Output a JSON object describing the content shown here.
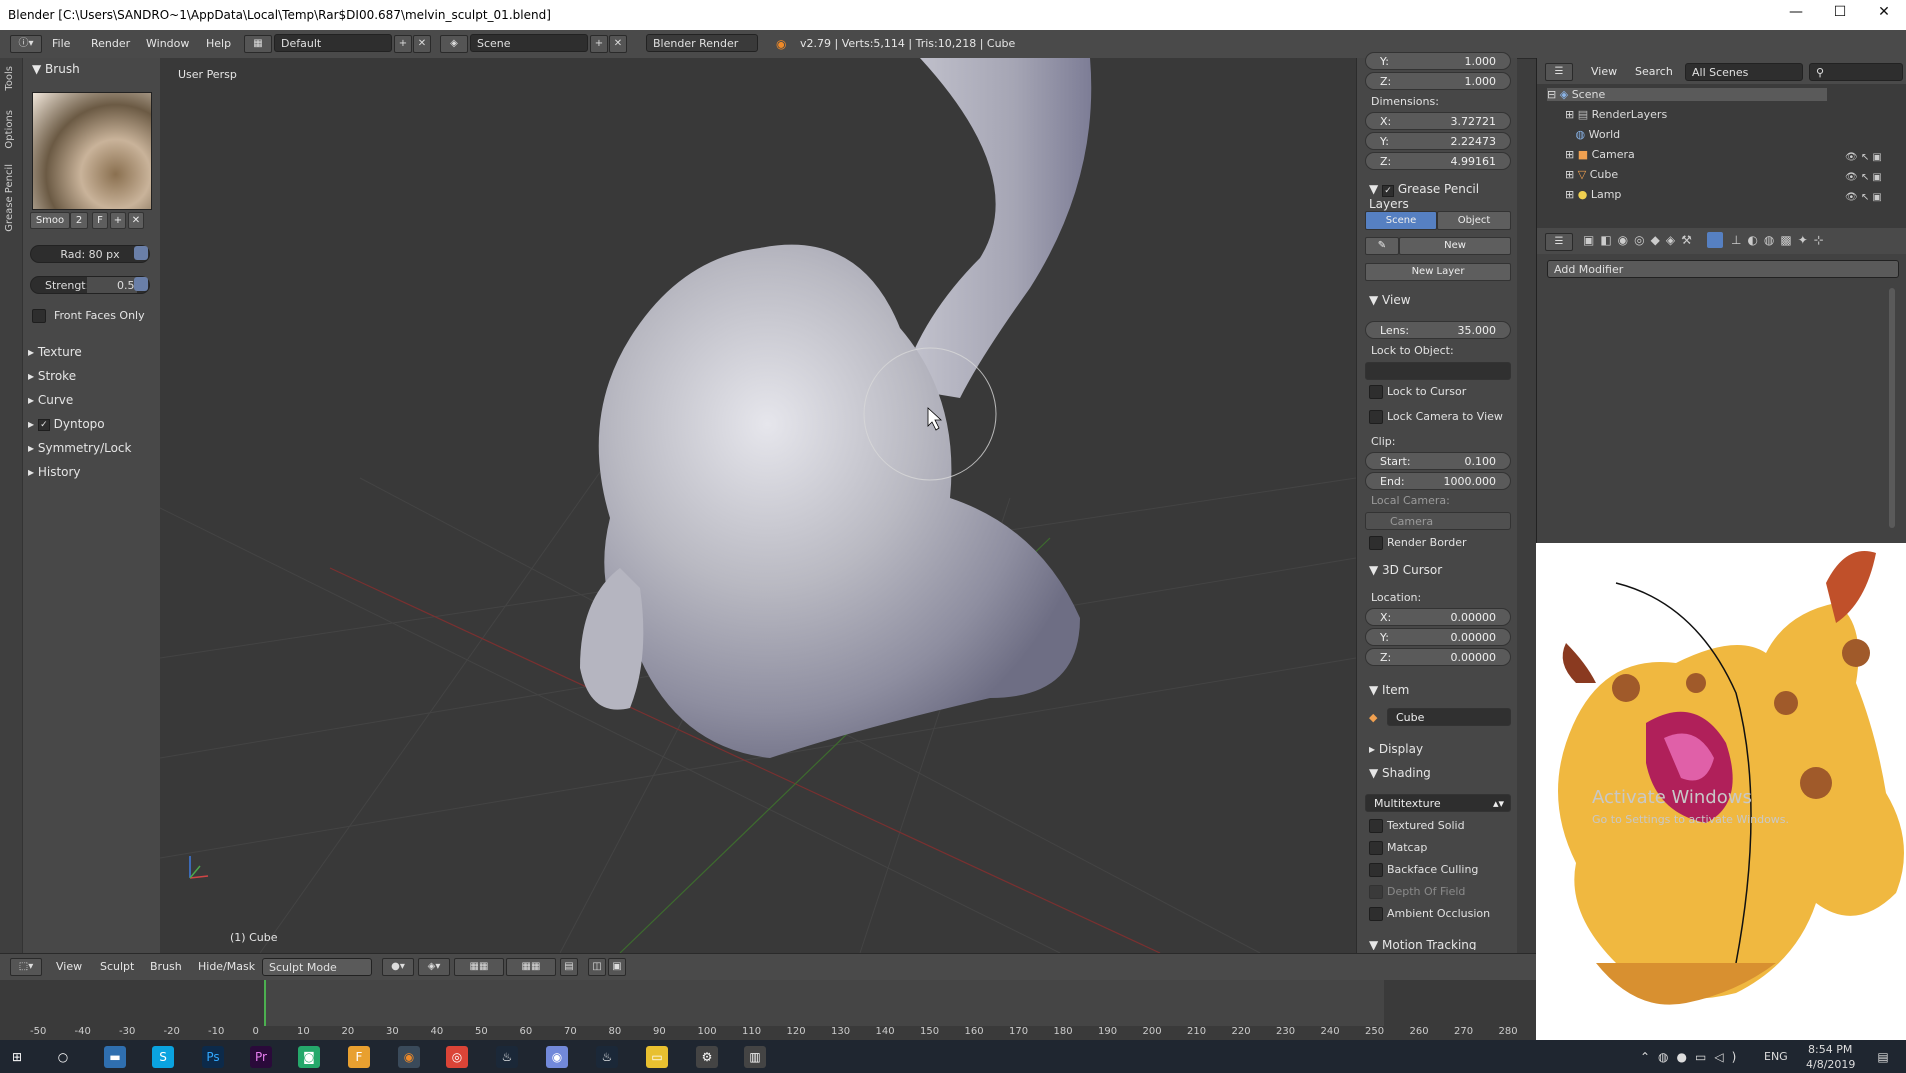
{
  "window": {
    "title": "Blender [C:\\Users\\SANDRO~1\\AppData\\Local\\Temp\\Rar$DI00.687\\melvin_sculpt_01.blend]",
    "minimize": "—",
    "maximize": "☐",
    "close": "✕"
  },
  "infobar": {
    "menus": [
      "File",
      "Render",
      "Window",
      "Help"
    ],
    "layout": "Default",
    "scene": "Scene",
    "engine": "Blender Render",
    "stats": "v2.79 | Verts:5,114 | Tris:10,218 | Cube"
  },
  "toolshelf": {
    "tabs": [
      "Tools",
      "Options",
      "Grease Pencil"
    ],
    "brush_header": "Brush",
    "brush_name": "Smoo",
    "brush_users": "2",
    "brush_fake": "F",
    "radius": "Rad: 80 px",
    "strength_label": "Strengt:",
    "strength_value": "0.500",
    "front_faces": "Front Faces Only",
    "panels": [
      "Texture",
      "Stroke",
      "Curve",
      "Dyntopo",
      "Symmetry/Lock",
      "History"
    ]
  },
  "viewport": {
    "view_name": "User Persp",
    "object_name": "(1) Cube"
  },
  "properties": {
    "scale_y": "Y:",
    "scale_y_val": "1.000",
    "scale_z": "Z:",
    "scale_z_val": "1.000",
    "dimensions_label": "Dimensions:",
    "dim_x": "X:",
    "dim_x_val": "3.72721",
    "dim_y": "Y:",
    "dim_y_val": "2.22473",
    "dim_z": "Z:",
    "dim_z_val": "4.99161",
    "gp_layers": "Grease Pencil Layers",
    "gp_scene": "Scene",
    "gp_object": "Object",
    "gp_new": "New",
    "gp_new_layer": "New Layer",
    "view_header": "View",
    "lens_label": "Lens:",
    "lens_val": "35.000",
    "lock_object": "Lock to Object:",
    "lock_cursor": "Lock to Cursor",
    "lock_camera": "Lock Camera to View",
    "clip_label": "Clip:",
    "clip_start": "Start:",
    "clip_start_val": "0.100",
    "clip_end": "End:",
    "clip_end_val": "1000.000",
    "local_camera": "Local Camera:",
    "camera": "Camera",
    "render_border": "Render Border",
    "cursor_header": "3D Cursor",
    "location_label": "Location:",
    "loc_x": "X:",
    "loc_x_val": "0.00000",
    "loc_y": "Y:",
    "loc_y_val": "0.00000",
    "loc_z": "Z:",
    "loc_z_val": "0.00000",
    "item_header": "Item",
    "item_name": "Cube",
    "display_header": "Display",
    "shading_header": "Shading",
    "shading_mode": "Multitexture",
    "textured_solid": "Textured Solid",
    "matcap": "Matcap",
    "backface": "Backface Culling",
    "dof": "Depth Of Field",
    "ao": "Ambient Occlusion",
    "motion_tracking": "Motion Tracking"
  },
  "outliner": {
    "view": "View",
    "search": "Search",
    "filter": "All Scenes",
    "items": [
      "Scene",
      "RenderLayers",
      "World",
      "Camera",
      "Cube",
      "Lamp"
    ]
  },
  "modifiers": {
    "add_modifier": "Add Modifier"
  },
  "reference": {
    "watermark1": "Activate Windows",
    "watermark2": "Go to Settings to activate Windows."
  },
  "bottombar": {
    "menus": [
      "View",
      "Sculpt",
      "Brush",
      "Hide/Mask"
    ],
    "mode": "Sculpt Mode"
  },
  "timeline": {
    "ticks": [
      "-50",
      "-40",
      "-30",
      "-20",
      "-10",
      "0",
      "10",
      "20",
      "30",
      "40",
      "50",
      "60",
      "70",
      "80",
      "90",
      "100",
      "110",
      "120",
      "130",
      "140",
      "150",
      "160",
      "170",
      "180",
      "190",
      "200",
      "210",
      "220",
      "230",
      "240",
      "250",
      "260",
      "270",
      "280"
    ]
  },
  "taskbar": {
    "lang": "ENG",
    "time": "8:54 PM",
    "date": "4/8/2019"
  }
}
